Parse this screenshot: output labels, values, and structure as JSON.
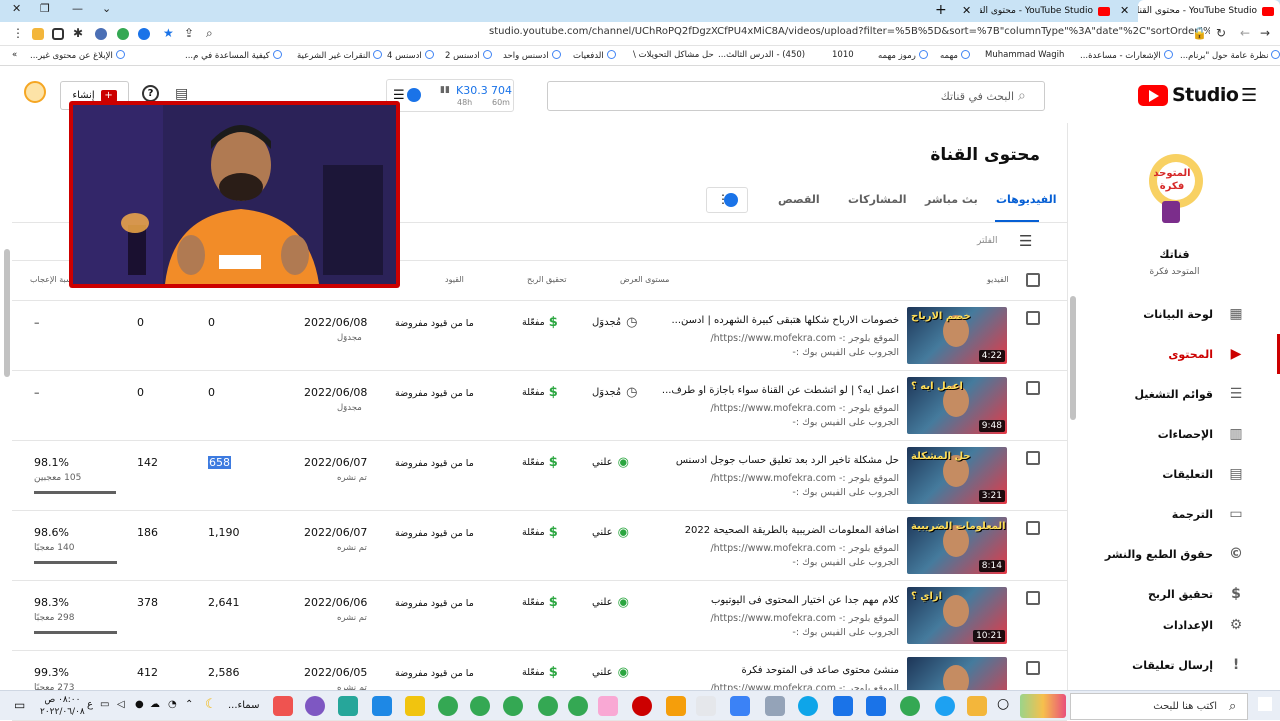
{
  "browser": {
    "tabs": [
      {
        "title": "YouTube Studio - محتوى القناة",
        "active": true
      },
      {
        "title": "YouTube Studio - محتوى القناة",
        "active": false
      }
    ],
    "new_tab": "+",
    "url": "studio.youtube.com/channel/UChRoPQ2fDgzXCfPU4xMiC8A/videos/upload?filter=%5B%5D&sort=%7B\"columnType\"%3A\"date\"%2C\"sortOrder\"%3A\"DESCENDING\"%7D",
    "bookmarks": [
      "نظرة عامة حول \"برنام...",
      "الإشعارات - مساعدة...",
      "Muhammad Wagih",
      "مهمه",
      "رموز مهمه",
      "1010",
      "(450) - الدرس الثالث...",
      "حل مشاكل التحويلات \\",
      "الدفعيات",
      "ادسنس واحد",
      "ادسنس 2",
      "ادسنس 4",
      "النقرات غير الشرعية",
      "كيفية المساعدة في م...",
      "الإبلاغ عن محتوى غير..."
    ]
  },
  "header": {
    "logo": "Studio",
    "search_placeholder": "البحث في قناتك",
    "stats": {
      "subs": "704",
      "subs_period": "60m",
      "views": "K30.3",
      "views_period": "48h"
    },
    "create_label": "إنشاء"
  },
  "sidebar": {
    "channel_name": "قناتك",
    "channel_sub": "المتوحد فكرة",
    "logo_text": "المتوحد فكرة",
    "items": [
      {
        "label": "لوحة البيانات",
        "icon": "dashboard-icon",
        "glyph": "▦",
        "active": false
      },
      {
        "label": "المحتوى",
        "icon": "content-icon",
        "glyph": "▶",
        "active": true
      },
      {
        "label": "قوائم التشغيل",
        "icon": "playlist-icon",
        "glyph": "☰",
        "active": false
      },
      {
        "label": "الإحصاءات",
        "icon": "analytics-icon",
        "glyph": "▥",
        "active": false
      },
      {
        "label": "التعليقات",
        "icon": "comments-icon",
        "glyph": "▤",
        "active": false
      },
      {
        "label": "الترجمة",
        "icon": "subtitles-icon",
        "glyph": "▭",
        "active": false
      },
      {
        "label": "حقوق الطبع والنشر",
        "icon": "copyright-icon",
        "glyph": "©",
        "active": false
      },
      {
        "label": "تحقيق الربح",
        "icon": "monetization-icon",
        "glyph": "$",
        "active": false
      }
    ],
    "settings": "الإعدادات",
    "feedback": "إرسال تعليقات"
  },
  "main": {
    "title": "محتوى القناة",
    "tabs": [
      "الفيديوهات",
      "بث مباشر",
      "المشاركات",
      "القصص"
    ],
    "filter_label": "الفلتر",
    "columns": {
      "video": "الفيديو",
      "visibility": "مستوى العرض",
      "monetization": "تحقيق الربح",
      "restrictions": "القيود",
      "likes": "نسبة الإعجاب"
    },
    "rows": [
      {
        "title": "خصومات الارباح شكلها هتبقى كبيرة الشهرده | ادسن...",
        "desc1": "الموقع بلوجر :- https://www.mofekra.com/",
        "desc2": "الجروب على الفيس بوك :-",
        "thumb_text": "خصم الارباح",
        "duration": "4:22",
        "visibility": "مُجدوَل",
        "vis_icon": "clock-icon",
        "monetization": "مفعّلة",
        "restrictions": "ما من قيود مفروضة",
        "date": "2022/06/08",
        "date_sub": "مجدوَل",
        "views": "0",
        "comments": "0",
        "likes": "–",
        "likes_sub": "",
        "like_ratio": 0,
        "highlight": false
      },
      {
        "title": "اعمل ايه؟ | لو اتشطت عن القناة سواء باجازة او طرف...",
        "desc1": "الموقع بلوجر :- https://www.mofekra.com/",
        "desc2": "الجروب على الفيس بوك :-",
        "thumb_text": "اعمل ايه ؟",
        "duration": "9:48",
        "visibility": "مُجدوَل",
        "vis_icon": "clock-icon",
        "monetization": "مفعّلة",
        "restrictions": "ما من قيود مفروضة",
        "date": "2022/06/08",
        "date_sub": "مجدوَل",
        "views": "0",
        "comments": "0",
        "likes": "–",
        "likes_sub": "",
        "like_ratio": 0,
        "highlight": false
      },
      {
        "title": "حل مشكلة تأخير الرد بعد تعليق حساب جوجل ادسنس",
        "desc1": "الموقع بلوجر :- https://www.mofekra.com/",
        "desc2": "الجروب على الفيس بوك :-",
        "thumb_text": "حل المشكلة",
        "duration": "3:21",
        "visibility": "علني",
        "vis_icon": "eye-icon",
        "monetization": "مفعّلة",
        "restrictions": "ما من قيود مفروضة",
        "date": "2022/06/07",
        "date_sub": "تم نشره",
        "views": "658",
        "comments": "142",
        "likes": "98.1%",
        "likes_sub": "105 معجبين",
        "like_ratio": 0.981,
        "highlight": true
      },
      {
        "title": "اضافة المعلومات الضريبية بالطريقة الصحيحة 2022",
        "desc1": "الموقع بلوجر :- https://www.mofekra.com/",
        "desc2": "الجروب على الفيس بوك :-",
        "thumb_text": "المعلومات الضريبية",
        "duration": "8:14",
        "visibility": "علني",
        "vis_icon": "eye-icon",
        "monetization": "مفعّلة",
        "restrictions": "ما من قيود مفروضة",
        "date": "2022/06/07",
        "date_sub": "تم نشره",
        "views": "1,190",
        "comments": "186",
        "likes": "98.6%",
        "likes_sub": "140 معجبًا",
        "like_ratio": 0.986,
        "highlight": false
      },
      {
        "title": "كلام مهم جدا عن اختيار المحتوى فى اليوتيوب",
        "desc1": "الموقع بلوجر :- https://www.mofekra.com/",
        "desc2": "الجروب على الفيس بوك :-",
        "thumb_text": "ازاي ؟",
        "duration": "10:21",
        "visibility": "علني",
        "vis_icon": "eye-icon",
        "monetization": "مفعّلة",
        "restrictions": "ما من قيود مفروضة",
        "date": "2022/06/06",
        "date_sub": "تم نشره",
        "views": "2,641",
        "comments": "378",
        "likes": "98.3%",
        "likes_sub": "298 معجبًا",
        "like_ratio": 0.983,
        "highlight": false
      },
      {
        "title": "منشئ محتوى صاعد فى المتوحد فكرة",
        "desc1": "الموقع بلوجر :- https://www.mofekra.com/",
        "desc2": "",
        "thumb_text": "",
        "duration": "",
        "visibility": "علني",
        "vis_icon": "eye-icon",
        "monetization": "مفعّلة",
        "restrictions": "ما من قيود مفروضة",
        "date": "2022/06/05",
        "date_sub": "تم نشره",
        "views": "2,586",
        "comments": "412",
        "likes": "99.3%",
        "likes_sub": "273 معجبًا",
        "like_ratio": 0.993,
        "highlight": false
      }
    ]
  },
  "taskbar": {
    "search_placeholder": "اكتب هنا للبحث",
    "clock_time": "٠٨:٠٠ ص",
    "clock_date": "٢٠٢٢/٠٦/٠٨",
    "weather": "سماء...",
    "lang": "ع"
  },
  "colors": {
    "accent": "#065fd4",
    "red": "#cc0000",
    "green": "#2ba640",
    "brand": "#ff0000"
  }
}
